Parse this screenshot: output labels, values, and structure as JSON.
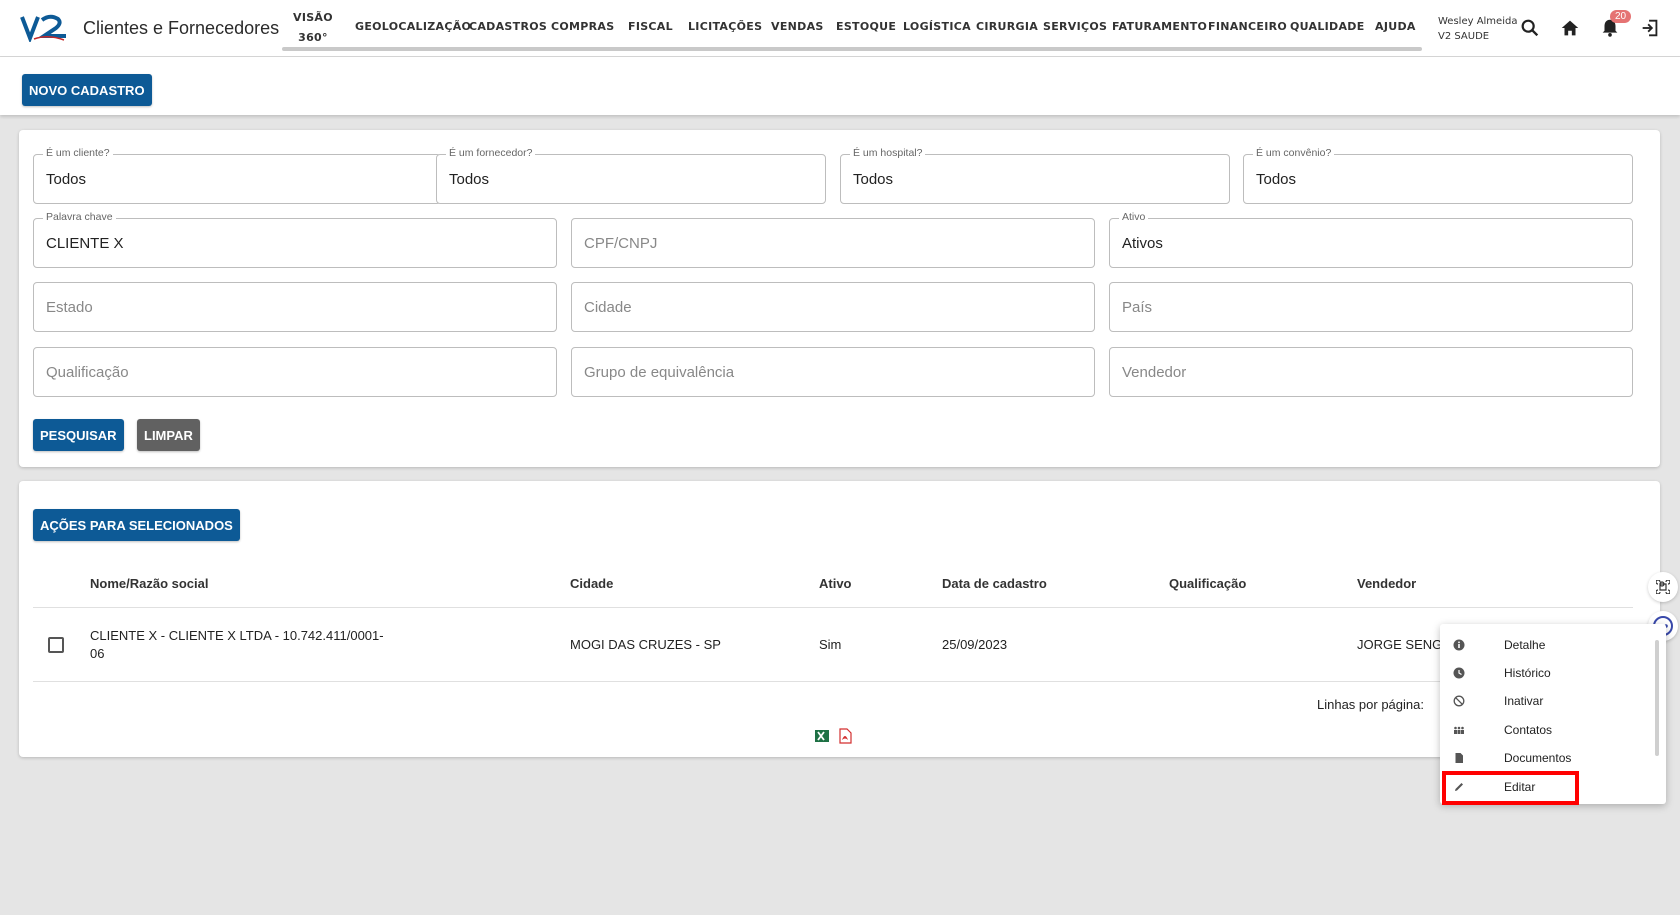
{
  "app": {
    "title": "Clientes e Fornecedores"
  },
  "menu": {
    "visao_line1": "VISÃO",
    "visao_line2": "360°",
    "items": [
      "GEOLOCALIZAÇÃO",
      "CADASTROS",
      "COMPRAS",
      "FISCAL",
      "LICITAÇÕES",
      "VENDAS",
      "ESTOQUE",
      "LOGÍSTICA",
      "CIRURGIA",
      "SERVIÇOS",
      "FATURAMENTO",
      "FINANCEIRO",
      "QUALIDADE",
      "AJUDA"
    ]
  },
  "user": {
    "name": "Wesley Almeida",
    "company": "V2 SAUDE",
    "notifications": "20"
  },
  "toolbar": {
    "new_label": "NOVO CADASTRO"
  },
  "filters": {
    "cliente": {
      "label": "É um cliente?",
      "value": "Todos"
    },
    "fornecedor": {
      "label": "É um fornecedor?",
      "value": "Todos"
    },
    "hospital": {
      "label": "É um hospital?",
      "value": "Todos"
    },
    "convenio": {
      "label": "É um convênio?",
      "value": "Todos"
    },
    "palavra": {
      "label": "Palavra chave",
      "value": "CLIENTE X"
    },
    "cpf": {
      "placeholder": "CPF/CNPJ"
    },
    "ativo": {
      "label": "Ativo",
      "value": "Ativos"
    },
    "estado": {
      "placeholder": "Estado"
    },
    "cidade": {
      "placeholder": "Cidade"
    },
    "pais": {
      "placeholder": "País"
    },
    "qualificacao": {
      "placeholder": "Qualificação"
    },
    "grupo": {
      "placeholder": "Grupo de equivalência"
    },
    "vendedor": {
      "placeholder": "Vendedor"
    },
    "search_label": "PESQUISAR",
    "clear_label": "LIMPAR"
  },
  "results": {
    "bulk_label": "AÇÕES PARA SELECIONADOS",
    "columns": {
      "nome": "Nome/Razão social",
      "cidade": "Cidade",
      "ativo": "Ativo",
      "data": "Data de cadastro",
      "qualificacao": "Qualificação",
      "vendedor": "Vendedor"
    },
    "row": {
      "nome_line1": "CLIENTE X - CLIENTE X LTDA - 10.742.411/0001-",
      "nome_line2": "06",
      "cidade": "MOGI DAS CRUZES - SP",
      "ativo": "Sim",
      "data": "25/09/2023",
      "vendedor": "JORGE SENGE"
    },
    "rows_per_page": "Linhas por página:"
  },
  "context_menu": {
    "items": [
      "Detalhe",
      "Histórico",
      "Inativar",
      "Contatos",
      "Documentos",
      "Editar"
    ],
    "icons": [
      "info-icon",
      "clock-icon",
      "block-icon",
      "people-icon",
      "document-icon",
      "pencil-icon"
    ]
  },
  "colors": {
    "primary": "#0d5a96",
    "secondary": "#616161",
    "highlight": "#ff0000",
    "badge": "#e57373"
  }
}
